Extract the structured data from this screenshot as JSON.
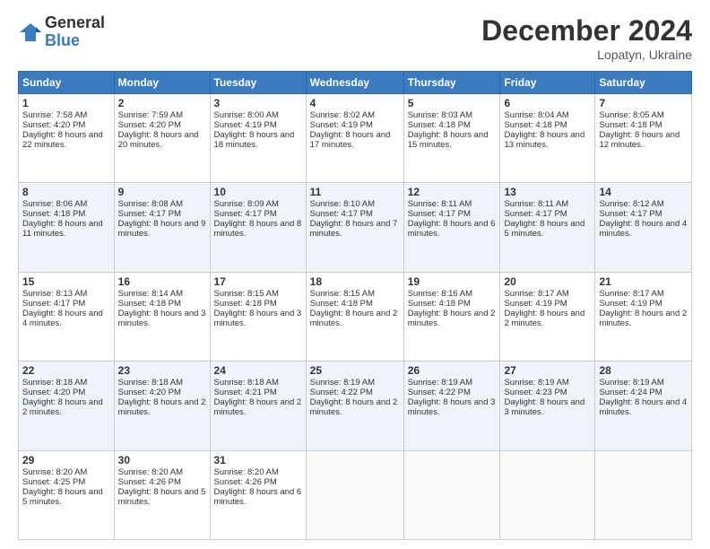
{
  "logo": {
    "general": "General",
    "blue": "Blue"
  },
  "title": "December 2024",
  "location": "Lopatyn, Ukraine",
  "days_header": [
    "Sunday",
    "Monday",
    "Tuesday",
    "Wednesday",
    "Thursday",
    "Friday",
    "Saturday"
  ],
  "weeks": [
    [
      {
        "day": "1",
        "sunrise": "7:58 AM",
        "sunset": "4:20 PM",
        "daylight": "8 hours and 22 minutes."
      },
      {
        "day": "2",
        "sunrise": "7:59 AM",
        "sunset": "4:20 PM",
        "daylight": "8 hours and 20 minutes."
      },
      {
        "day": "3",
        "sunrise": "8:00 AM",
        "sunset": "4:19 PM",
        "daylight": "8 hours and 18 minutes."
      },
      {
        "day": "4",
        "sunrise": "8:02 AM",
        "sunset": "4:19 PM",
        "daylight": "8 hours and 17 minutes."
      },
      {
        "day": "5",
        "sunrise": "8:03 AM",
        "sunset": "4:18 PM",
        "daylight": "8 hours and 15 minutes."
      },
      {
        "day": "6",
        "sunrise": "8:04 AM",
        "sunset": "4:18 PM",
        "daylight": "8 hours and 13 minutes."
      },
      {
        "day": "7",
        "sunrise": "8:05 AM",
        "sunset": "4:18 PM",
        "daylight": "8 hours and 12 minutes."
      }
    ],
    [
      {
        "day": "8",
        "sunrise": "8:06 AM",
        "sunset": "4:18 PM",
        "daylight": "8 hours and 11 minutes."
      },
      {
        "day": "9",
        "sunrise": "8:08 AM",
        "sunset": "4:17 PM",
        "daylight": "8 hours and 9 minutes."
      },
      {
        "day": "10",
        "sunrise": "8:09 AM",
        "sunset": "4:17 PM",
        "daylight": "8 hours and 8 minutes."
      },
      {
        "day": "11",
        "sunrise": "8:10 AM",
        "sunset": "4:17 PM",
        "daylight": "8 hours and 7 minutes."
      },
      {
        "day": "12",
        "sunrise": "8:11 AM",
        "sunset": "4:17 PM",
        "daylight": "8 hours and 6 minutes."
      },
      {
        "day": "13",
        "sunrise": "8:11 AM",
        "sunset": "4:17 PM",
        "daylight": "8 hours and 5 minutes."
      },
      {
        "day": "14",
        "sunrise": "8:12 AM",
        "sunset": "4:17 PM",
        "daylight": "8 hours and 4 minutes."
      }
    ],
    [
      {
        "day": "15",
        "sunrise": "8:13 AM",
        "sunset": "4:17 PM",
        "daylight": "8 hours and 4 minutes."
      },
      {
        "day": "16",
        "sunrise": "8:14 AM",
        "sunset": "4:18 PM",
        "daylight": "8 hours and 3 minutes."
      },
      {
        "day": "17",
        "sunrise": "8:15 AM",
        "sunset": "4:18 PM",
        "daylight": "8 hours and 3 minutes."
      },
      {
        "day": "18",
        "sunrise": "8:15 AM",
        "sunset": "4:18 PM",
        "daylight": "8 hours and 2 minutes."
      },
      {
        "day": "19",
        "sunrise": "8:16 AM",
        "sunset": "4:18 PM",
        "daylight": "8 hours and 2 minutes."
      },
      {
        "day": "20",
        "sunrise": "8:17 AM",
        "sunset": "4:19 PM",
        "daylight": "8 hours and 2 minutes."
      },
      {
        "day": "21",
        "sunrise": "8:17 AM",
        "sunset": "4:19 PM",
        "daylight": "8 hours and 2 minutes."
      }
    ],
    [
      {
        "day": "22",
        "sunrise": "8:18 AM",
        "sunset": "4:20 PM",
        "daylight": "8 hours and 2 minutes."
      },
      {
        "day": "23",
        "sunrise": "8:18 AM",
        "sunset": "4:20 PM",
        "daylight": "8 hours and 2 minutes."
      },
      {
        "day": "24",
        "sunrise": "8:18 AM",
        "sunset": "4:21 PM",
        "daylight": "8 hours and 2 minutes."
      },
      {
        "day": "25",
        "sunrise": "8:19 AM",
        "sunset": "4:22 PM",
        "daylight": "8 hours and 2 minutes."
      },
      {
        "day": "26",
        "sunrise": "8:19 AM",
        "sunset": "4:22 PM",
        "daylight": "8 hours and 3 minutes."
      },
      {
        "day": "27",
        "sunrise": "8:19 AM",
        "sunset": "4:23 PM",
        "daylight": "8 hours and 3 minutes."
      },
      {
        "day": "28",
        "sunrise": "8:19 AM",
        "sunset": "4:24 PM",
        "daylight": "8 hours and 4 minutes."
      }
    ],
    [
      {
        "day": "29",
        "sunrise": "8:20 AM",
        "sunset": "4:25 PM",
        "daylight": "8 hours and 5 minutes."
      },
      {
        "day": "30",
        "sunrise": "8:20 AM",
        "sunset": "4:26 PM",
        "daylight": "8 hours and 5 minutes."
      },
      {
        "day": "31",
        "sunrise": "8:20 AM",
        "sunset": "4:26 PM",
        "daylight": "8 hours and 6 minutes."
      },
      null,
      null,
      null,
      null
    ]
  ],
  "labels": {
    "sunrise": "Sunrise:",
    "sunset": "Sunset:",
    "daylight": "Daylight:"
  }
}
